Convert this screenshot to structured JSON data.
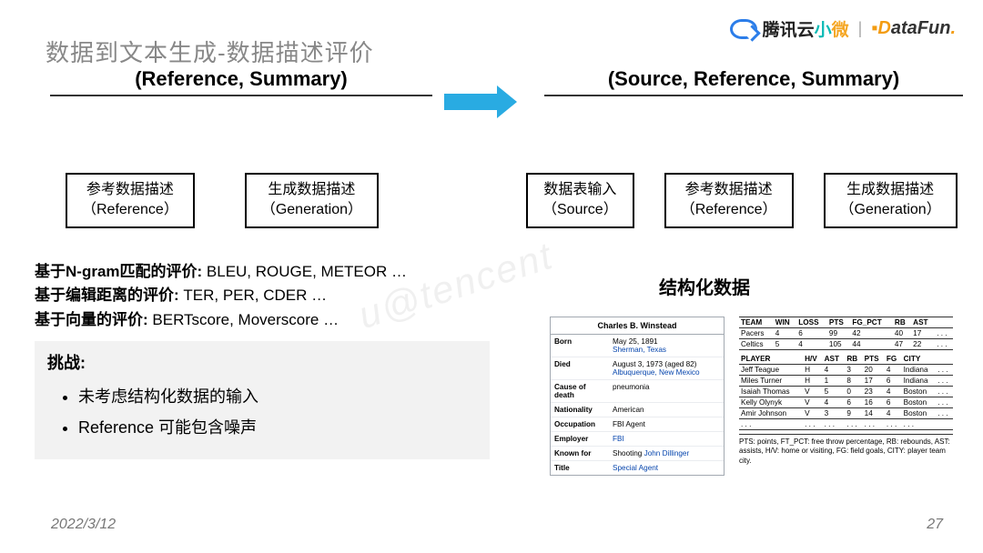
{
  "header": {
    "title": "数据到文本生成-数据描述评价",
    "tencent_prefix": "腾讯云",
    "tencent_xiao": "小",
    "tencent_wei": "微",
    "datafun_d": "D",
    "datafun_rest": "ataFun",
    "datafun_dot": "."
  },
  "headings": {
    "left": "(Reference, Summary)",
    "right": "(Source, Reference, Summary)"
  },
  "boxes_left": [
    {
      "line1": "参考数据描述",
      "line2": "（Reference）"
    },
    {
      "line1": "生成数据描述",
      "line2": "（Generation）"
    }
  ],
  "boxes_right": [
    {
      "line1": "数据表输入",
      "line2": "（Source）"
    },
    {
      "line1": "参考数据描述",
      "line2": "（Reference）"
    },
    {
      "line1": "生成数据描述",
      "line2": "（Generation）"
    }
  ],
  "metrics": {
    "l1b": "基于N-gram匹配的评价:",
    "l1r": " BLEU, ROUGE, METEOR …",
    "l2b": "基于编辑距离的评价:",
    "l2r": " TER, PER, CDER …",
    "l3b": "基于向量的评价:",
    "l3r": " BERTscore, Moverscore …"
  },
  "subtitle_right": "结构化数据",
  "challenges": {
    "header": "挑战:",
    "items": [
      "未考虑结构化数据的输入",
      "Reference 可能包含噪声"
    ]
  },
  "wiki": {
    "title": "Charles B. Winstead",
    "rows": [
      {
        "k": "Born",
        "v": "May 25, 1891",
        "sub": "Sherman, Texas"
      },
      {
        "k": "Died",
        "v": "August 3, 1973 (aged 82)",
        "sub": "Albuquerque, New Mexico"
      },
      {
        "k": "Cause of death",
        "v": "pneumonia"
      },
      {
        "k": "Nationality",
        "v": "American"
      },
      {
        "k": "Occupation",
        "v": "FBI Agent"
      },
      {
        "k": "Employer",
        "v": "FBI",
        "link": true
      },
      {
        "k": "Known for",
        "v_pre": "Shooting ",
        "v_link": "John Dillinger"
      },
      {
        "k": "Title",
        "v": "Special Agent",
        "link": true
      }
    ]
  },
  "stats": {
    "team_headers": [
      "TEAM",
      "WIN",
      "LOSS",
      "PTS",
      "FG_PCT",
      "RB",
      "AST",
      ""
    ],
    "team_rows": [
      [
        "Pacers",
        "4",
        "6",
        "99",
        "42",
        "40",
        "17",
        ". . ."
      ],
      [
        "Celtics",
        "5",
        "4",
        "105",
        "44",
        "47",
        "22",
        ". . ."
      ]
    ],
    "player_headers": [
      "PLAYER",
      "H/V",
      "AST",
      "RB",
      "PTS",
      "FG",
      "CITY",
      ""
    ],
    "player_rows": [
      [
        "Jeff Teague",
        "H",
        "4",
        "3",
        "20",
        "4",
        "Indiana",
        ". . ."
      ],
      [
        "Miles Turner",
        "H",
        "1",
        "8",
        "17",
        "6",
        "Indiana",
        ". . ."
      ],
      [
        "Isaiah Thomas",
        "V",
        "5",
        "0",
        "23",
        "4",
        "Boston",
        ". . ."
      ],
      [
        "Kelly Olynyk",
        "V",
        "4",
        "6",
        "16",
        "6",
        "Boston",
        ". . ."
      ],
      [
        "Amir Johnson",
        "V",
        "3",
        "9",
        "14",
        "4",
        "Boston",
        ". . ."
      ],
      [
        ". . .",
        ". . .",
        ". . .",
        ". . .",
        ". . .",
        ". . .",
        ". . .",
        ""
      ]
    ],
    "caption": "PTS: points, FT_PCT: free throw percentage, RB: rebounds, AST: assists, H/V: home or visiting, FG: field goals, CITY: player team city."
  },
  "footer": {
    "date": "2022/3/12",
    "page": "27"
  },
  "watermark": "u@tencent"
}
